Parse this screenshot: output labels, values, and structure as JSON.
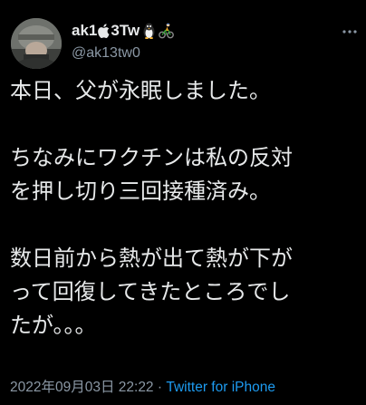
{
  "author": {
    "name_prefix": "ak1",
    "name_suffix": "3Tw",
    "handle": "@ak13tw0",
    "name_icons": [
      "apple-icon",
      "penguin-icon",
      "cyclist-icon"
    ]
  },
  "tweet": {
    "lines": [
      "本日、父が永眠しました。",
      "",
      "ちなみにワクチンは私の反対",
      "を押し切り三回接種済み。",
      "",
      "数日前から熱が出て熱が下が",
      "って回復してきたところでし",
      "たが。。。"
    ],
    "timestamp": "2022年09月03日 22:22",
    "separator": "·",
    "source": "Twitter for iPhone"
  },
  "colors": {
    "background": "#000000",
    "text": "#e7e9ea",
    "secondary": "#8b98a5",
    "link": "#1d9bf0"
  }
}
